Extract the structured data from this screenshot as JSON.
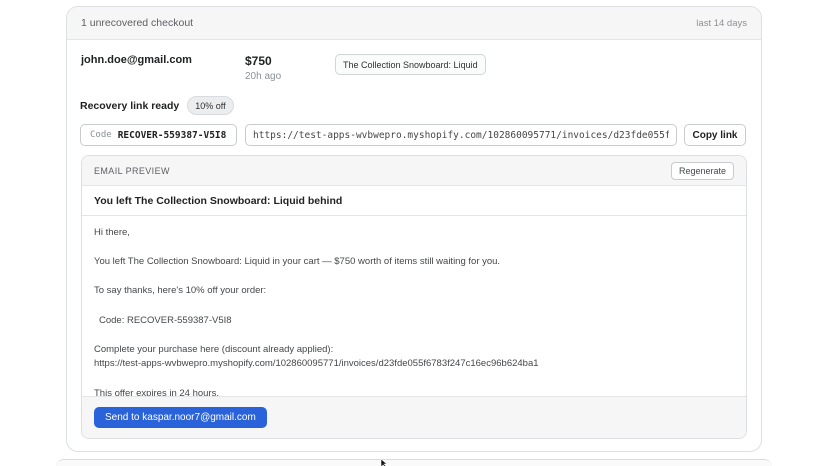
{
  "card": {
    "title": "1 unrecovered checkout",
    "range": "last 14 days"
  },
  "checkout": {
    "email": "john.doe@gmail.com",
    "amount": "$750",
    "time_ago": "20h ago",
    "product": "The Collection Snowboard: Liquid"
  },
  "recovery": {
    "ready_label": "Recovery link ready",
    "discount_badge": "10% off",
    "code_label": "Code",
    "code_value": "RECOVER-559387-V5I8",
    "url": "https://test-apps-wvbwepro.myshopify.com/102860095771/invoices/d23fde055f6783f",
    "copy_label": "Copy link"
  },
  "preview": {
    "label": "EMAIL PREVIEW",
    "regenerate_label": "Regenerate",
    "subject": "You left The Collection Snowboard: Liquid behind",
    "lines": {
      "greeting": "Hi there,",
      "cart": "You left The Collection Snowboard: Liquid in your cart — $750 worth of items still waiting for you.",
      "thanks": "To say thanks, here's 10% off your order:",
      "code": "Code: RECOVER-559387-V5I8",
      "complete": "Complete your purchase here (discount already applied):",
      "link": "https://test-apps-wvbwepro.myshopify.com/102860095771/invoices/d23fde055f6783f247c16ec96b624ba1",
      "expires": "This offer expires in 24 hours."
    },
    "send_label": "Send to kaspar.noor7@gmail.com"
  },
  "colors": {
    "primary_button": "#2a62d9",
    "header_bg": "#f6f6f7"
  },
  "icons": {
    "cursor": "mouse-pointer-icon"
  }
}
